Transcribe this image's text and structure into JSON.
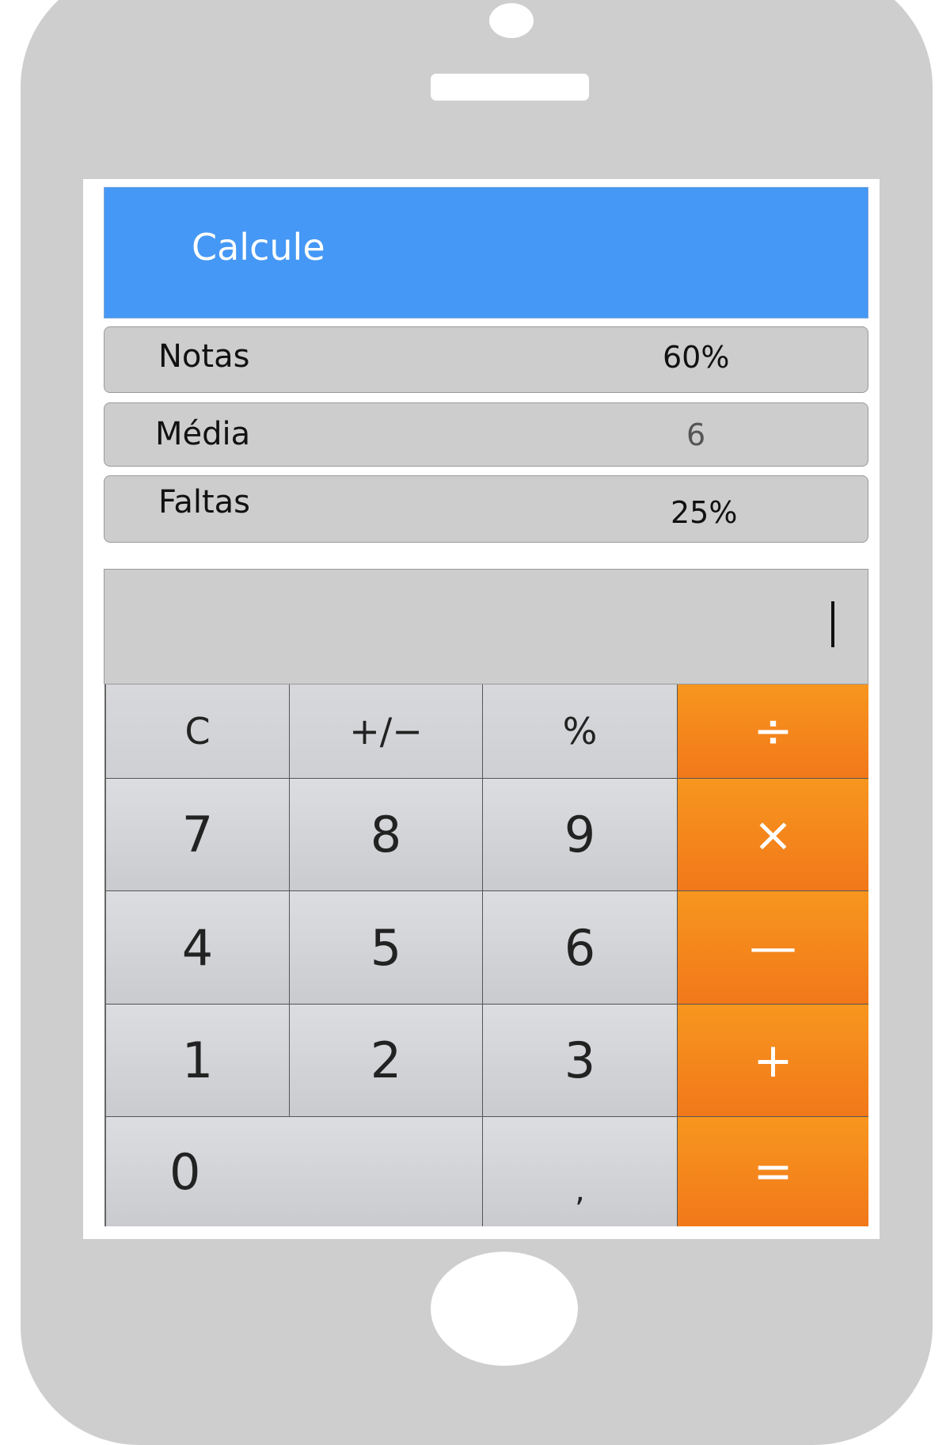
{
  "app": {
    "title": "Calcule"
  },
  "rows": [
    {
      "label": "Notas",
      "value": "60%"
    },
    {
      "label": "Média",
      "value": "6"
    },
    {
      "label": "Faltas",
      "value": "25%"
    }
  ],
  "display": {
    "value": ""
  },
  "keys": {
    "clear": "C",
    "sign": "+∕−",
    "percent": "%",
    "divide": "÷",
    "seven": "7",
    "eight": "8",
    "nine": "9",
    "multiply": "×",
    "four": "4",
    "five": "5",
    "six": "6",
    "minus": "—",
    "one": "1",
    "two": "2",
    "three": "3",
    "plus": "+",
    "zero": "0",
    "comma": ",",
    "equals": "="
  },
  "colors": {
    "header": "#4598f5",
    "operator": "#f5891c",
    "key_light": "#d4d5d8",
    "phone": "#cecece"
  }
}
